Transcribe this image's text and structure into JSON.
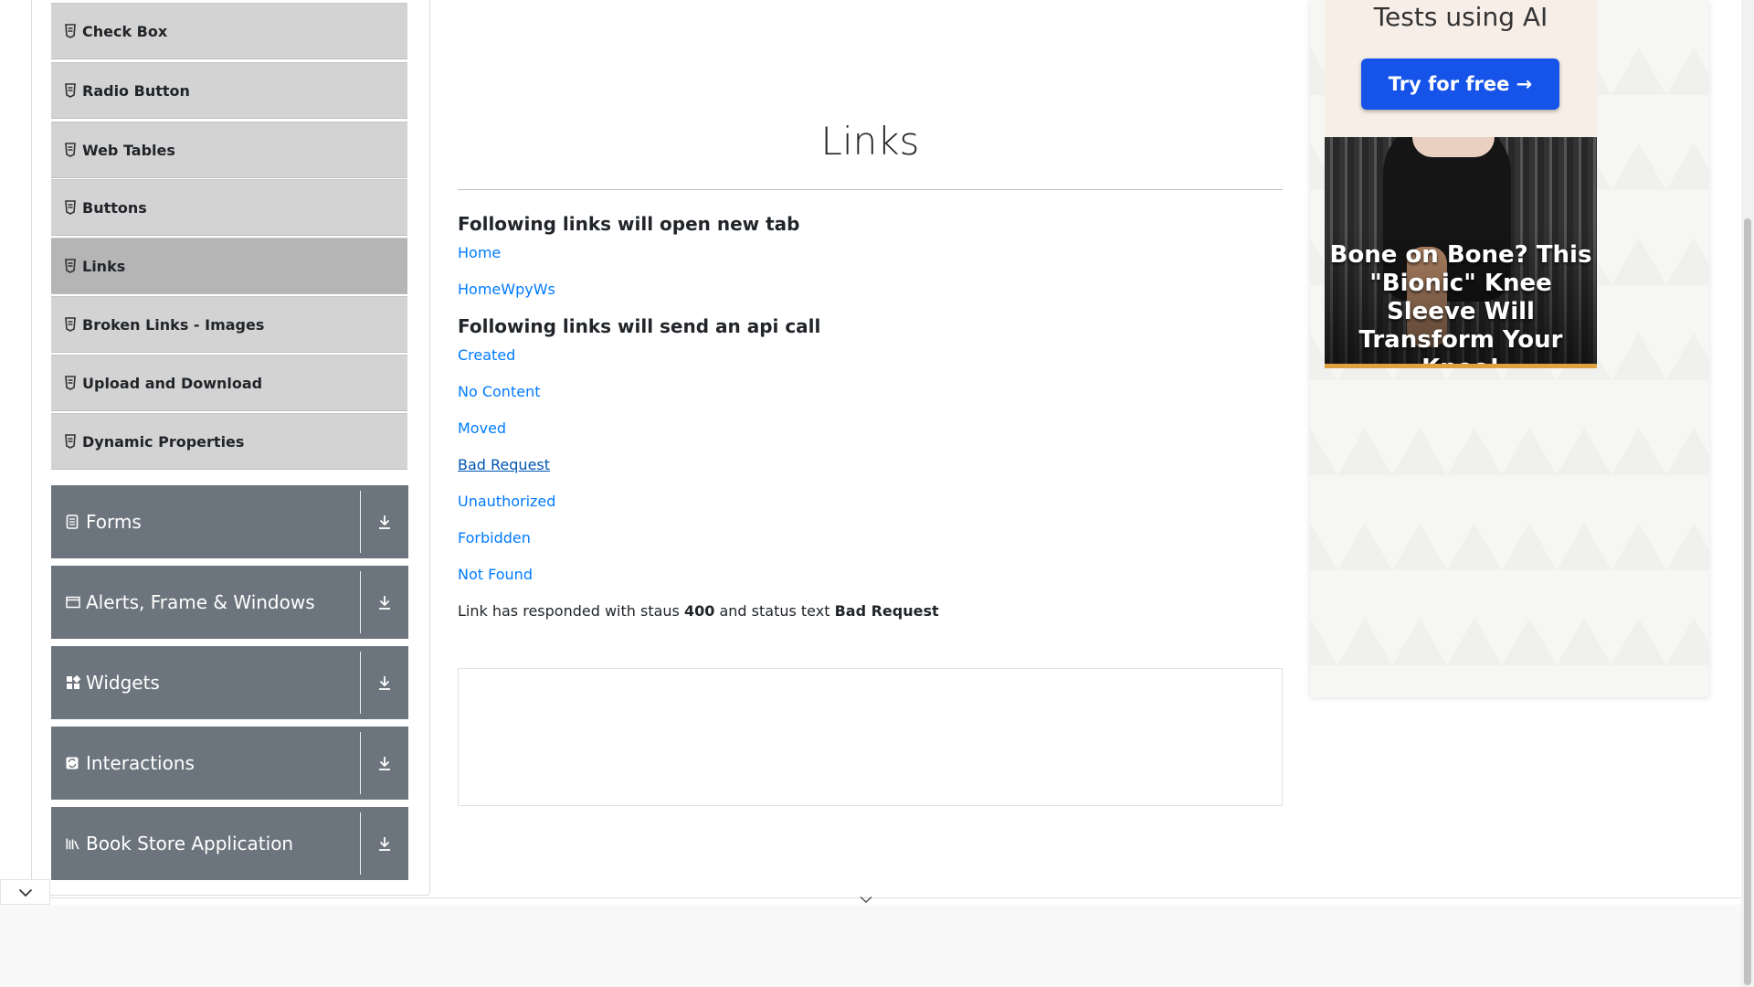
{
  "sidebar": {
    "subitems": [
      {
        "label": "Check Box",
        "active": false
      },
      {
        "label": "Radio Button",
        "active": false
      },
      {
        "label": "Web Tables",
        "active": false
      },
      {
        "label": "Buttons",
        "active": false
      },
      {
        "label": "Links",
        "active": true
      },
      {
        "label": "Broken Links - Images",
        "active": false
      },
      {
        "label": "Upload and Download",
        "active": false
      },
      {
        "label": "Dynamic Properties",
        "active": false
      }
    ],
    "groups": [
      {
        "label": "Forms",
        "icon": "form-icon"
      },
      {
        "label": "Alerts, Frame & Windows",
        "icon": "window-icon"
      },
      {
        "label": "Widgets",
        "icon": "widgets-icon"
      },
      {
        "label": "Interactions",
        "icon": "interactions-icon"
      },
      {
        "label": "Book Store Application",
        "icon": "bookstore-icon"
      }
    ]
  },
  "main": {
    "title": "Links",
    "new_tab_heading": "Following links will open new tab",
    "new_tab_links": [
      "Home",
      "HomeWpyWs"
    ],
    "api_heading": "Following links will send an api call",
    "api_links": [
      "Created",
      "No Content",
      "Moved",
      "Bad Request",
      "Unauthorized",
      "Forbidden",
      "Not Found"
    ],
    "response": {
      "prefix": "Link has responded with staus",
      "status_code": "400",
      "middle": "and status text",
      "status_text": "Bad Request"
    }
  },
  "ad": {
    "top_text": "Tests using AI",
    "button_label": "Try for free →",
    "headline": "Bone on Bone? This \"Bionic\" Knee Sleeve Will Transform Your Knee!"
  },
  "colors": {
    "link": "#007bff",
    "group_bg": "#6c757d",
    "subitem_bg": "#d3d3d3",
    "active_bg": "#b5b5b5",
    "ad_button": "#1653e8"
  }
}
